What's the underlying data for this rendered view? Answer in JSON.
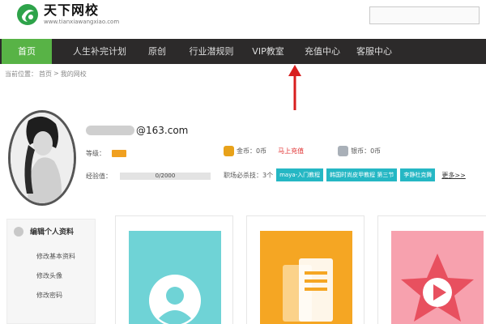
{
  "header": {
    "logo_title": "天下网校",
    "logo_url": "www.tianxiawangxiao.com"
  },
  "nav": {
    "items": [
      {
        "label": "首页",
        "active": true
      },
      {
        "label": "人生补完计划",
        "active": false
      },
      {
        "label": "原创",
        "active": false
      },
      {
        "label": "行业潜规则",
        "active": false
      },
      {
        "label": "VIP教室",
        "active": false
      },
      {
        "label": "充值中心",
        "active": false
      },
      {
        "label": "客服中心",
        "active": false
      }
    ]
  },
  "breadcrumb": {
    "prefix": "当前位置：",
    "home": "首页",
    "separator": ">",
    "current": "我的网校"
  },
  "profile": {
    "email_suffix": "@163.com",
    "level_label": "等级：",
    "exp_label": "经验值：",
    "exp_value": "0/2000",
    "exp_progress": 0
  },
  "wallet": {
    "gold_label": "金币：0币",
    "recharge_link": "马上充值",
    "silver_label": "银币：0币"
  },
  "courses": {
    "label": "职场必杀技：3个",
    "tags": [
      "maya-入门教程",
      "韩国时尚皮甲教程 第三节",
      "李静杜克舞"
    ],
    "more": "更多>>"
  },
  "sidebar": {
    "title": "编辑个人资料",
    "items": [
      "修改基本资料",
      "修改头像",
      "修改密码"
    ]
  },
  "colors": {
    "nav_bg": "#2c2a2a",
    "nav_active": "#58b346",
    "tag_bg": "#25b7c4",
    "card1": "#6fd3d6",
    "card2": "#f5a623",
    "card3": "#f7a1ae",
    "arrow": "#d81e1e"
  },
  "icons": {
    "logo": "logo-mark-icon",
    "gold": "gold-coin-icon",
    "silver": "silver-coin-icon",
    "card1": "user-icon",
    "card2": "books-icon",
    "card3": "star-play-icon"
  }
}
